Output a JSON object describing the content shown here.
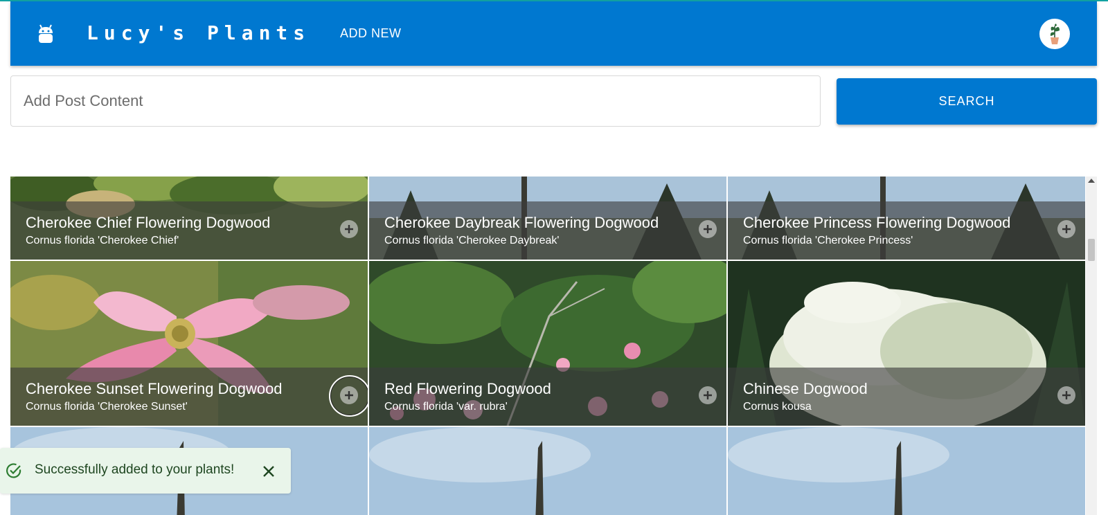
{
  "header": {
    "title": "Lucy's Plants",
    "add_new_label": "ADD NEW",
    "logo_icon": "android-icon",
    "avatar_icon": "potted-plant-icon",
    "bar_color": "#0078d0"
  },
  "search": {
    "placeholder": "Add Post Content",
    "value": "",
    "button_label": "SEARCH"
  },
  "plants": [
    {
      "name": "Cherokee Chief Flowering Dogwood",
      "scientific": "Cornus florida 'Cherokee Chief'"
    },
    {
      "name": "Cherokee Daybreak Flowering Dogwood",
      "scientific": "Cornus florida 'Cherokee Daybreak'"
    },
    {
      "name": "Cherokee Princess Flowering Dogwood",
      "scientific": "Cornus florida 'Cherokee Princess'"
    },
    {
      "name": "Cherokee Sunset Flowering Dogwood",
      "scientific": "Cornus florida 'Cherokee Sunset'"
    },
    {
      "name": "Red Flowering Dogwood",
      "scientific": "Cornus florida 'var. rubra'"
    },
    {
      "name": "Chinese Dogwood",
      "scientific": "Cornus kousa"
    }
  ],
  "toast": {
    "message": "Successfully added to your plants!",
    "status": "success",
    "color": "#e9f5ea",
    "icon": "check-circle-icon",
    "close_icon": "close-icon"
  }
}
